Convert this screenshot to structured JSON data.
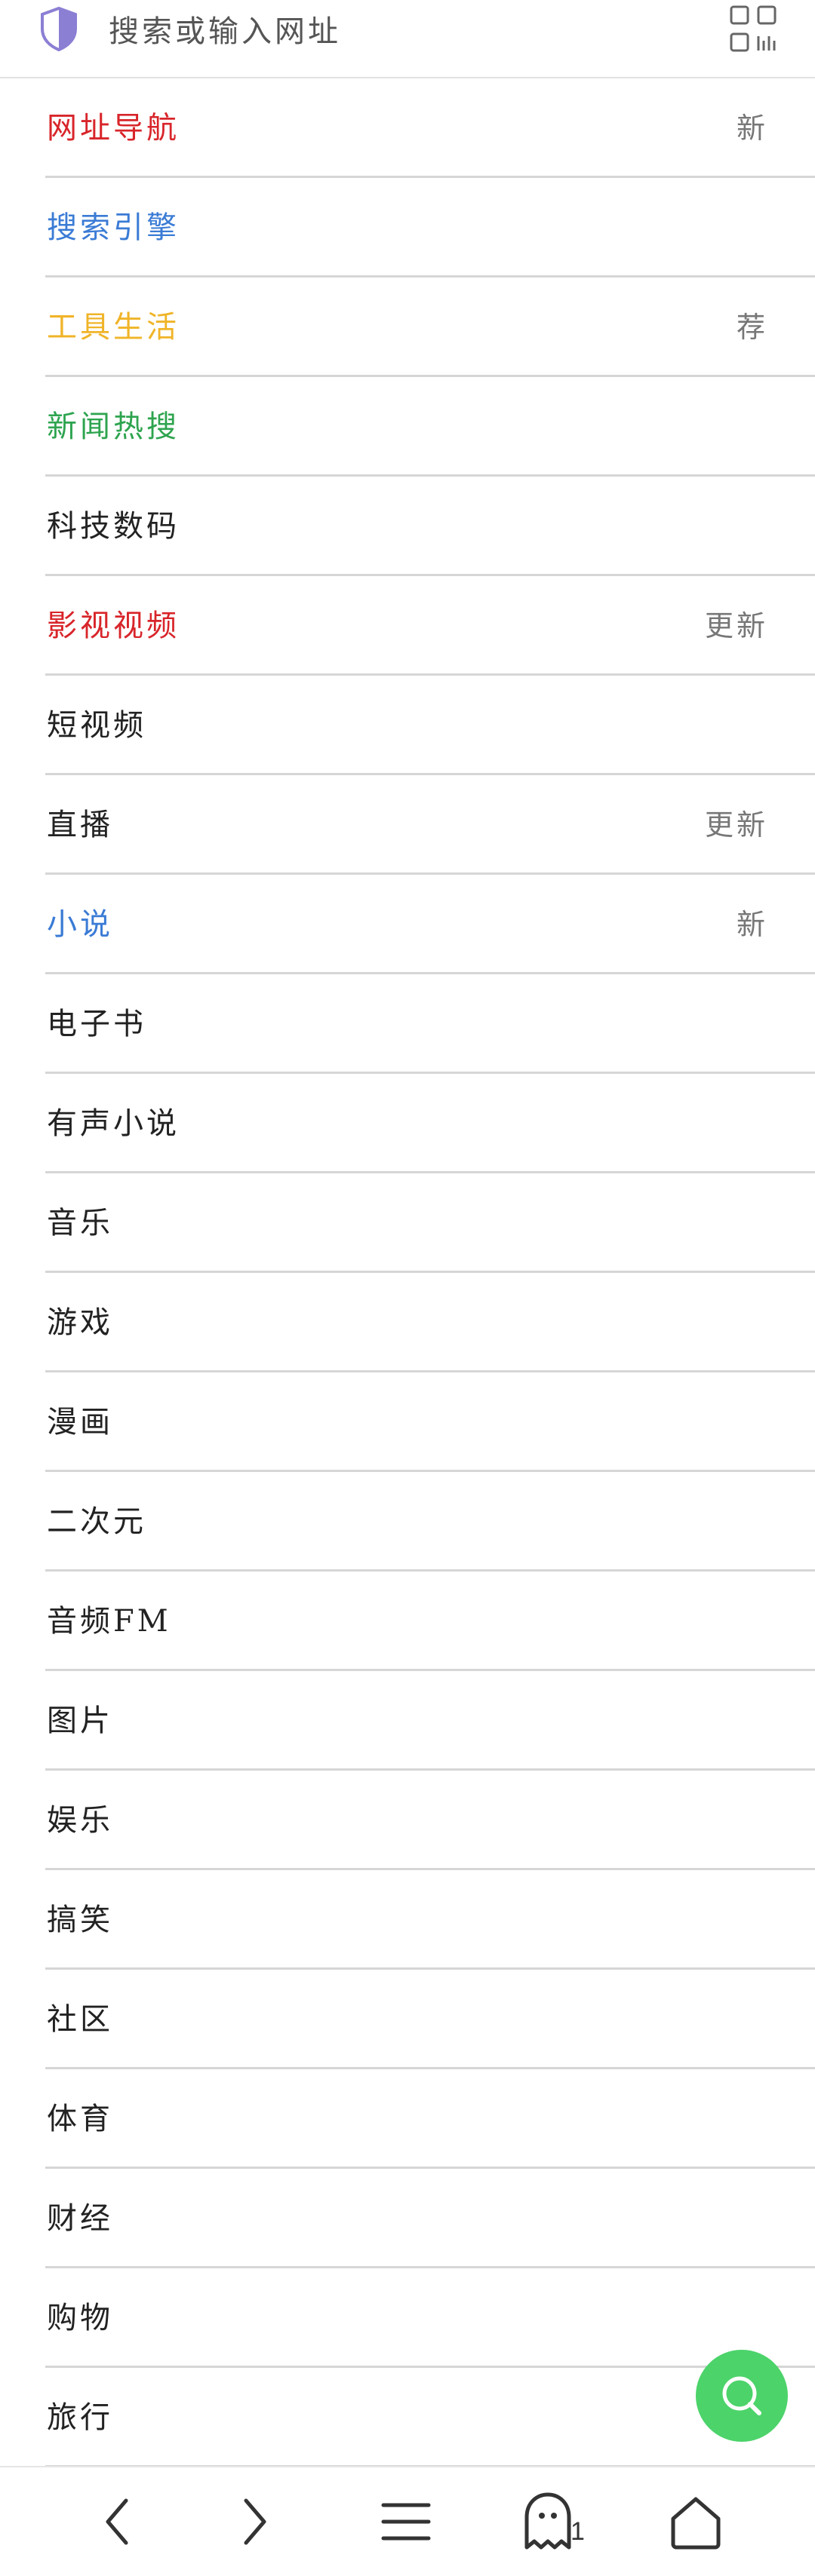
{
  "search": {
    "placeholder": "搜索或输入网址",
    "shield_icon": "shield-icon",
    "qr_icon": "qr-code-icon"
  },
  "colors": {
    "red": "#d8252a",
    "blue": "#3a7bd5",
    "yellow": "#f0b429",
    "green": "#2ea44f",
    "text": "#222222",
    "badge": "#777777",
    "fab": "#4cd36a",
    "shield": "#8b7fd4"
  },
  "categories": [
    {
      "label": "网址导航",
      "color": "#d8252a",
      "badge": "新"
    },
    {
      "label": "搜索引擎",
      "color": "#3a7bd5",
      "badge": ""
    },
    {
      "label": "工具生活",
      "color": "#f0b429",
      "badge": "荐"
    },
    {
      "label": "新闻热搜",
      "color": "#2ea44f",
      "badge": ""
    },
    {
      "label": "科技数码",
      "color": "#222222",
      "badge": ""
    },
    {
      "label": "影视视频",
      "color": "#d8252a",
      "badge": "更新"
    },
    {
      "label": "短视频",
      "color": "#222222",
      "badge": ""
    },
    {
      "label": "直播",
      "color": "#222222",
      "badge": "更新"
    },
    {
      "label": "小说",
      "color": "#3a7bd5",
      "badge": "新"
    },
    {
      "label": "电子书",
      "color": "#222222",
      "badge": ""
    },
    {
      "label": "有声小说",
      "color": "#222222",
      "badge": ""
    },
    {
      "label": "音乐",
      "color": "#222222",
      "badge": ""
    },
    {
      "label": "游戏",
      "color": "#222222",
      "badge": ""
    },
    {
      "label": "漫画",
      "color": "#222222",
      "badge": ""
    },
    {
      "label": "二次元",
      "color": "#222222",
      "badge": ""
    },
    {
      "label": "音频FM",
      "color": "#222222",
      "badge": ""
    },
    {
      "label": "图片",
      "color": "#222222",
      "badge": ""
    },
    {
      "label": "娱乐",
      "color": "#222222",
      "badge": ""
    },
    {
      "label": "搞笑",
      "color": "#222222",
      "badge": ""
    },
    {
      "label": "社区",
      "color": "#222222",
      "badge": ""
    },
    {
      "label": "体育",
      "color": "#222222",
      "badge": ""
    },
    {
      "label": "财经",
      "color": "#222222",
      "badge": ""
    },
    {
      "label": "购物",
      "color": "#222222",
      "badge": ""
    },
    {
      "label": "旅行",
      "color": "#222222",
      "badge": ""
    }
  ],
  "fab": {
    "icon": "search-icon"
  },
  "bottom_nav": {
    "items": [
      {
        "icon": "back-arrow-icon"
      },
      {
        "icon": "forward-arrow-icon"
      },
      {
        "icon": "menu-icon"
      },
      {
        "icon": "ghost-tabs-icon",
        "count": "1"
      },
      {
        "icon": "home-icon"
      }
    ]
  }
}
